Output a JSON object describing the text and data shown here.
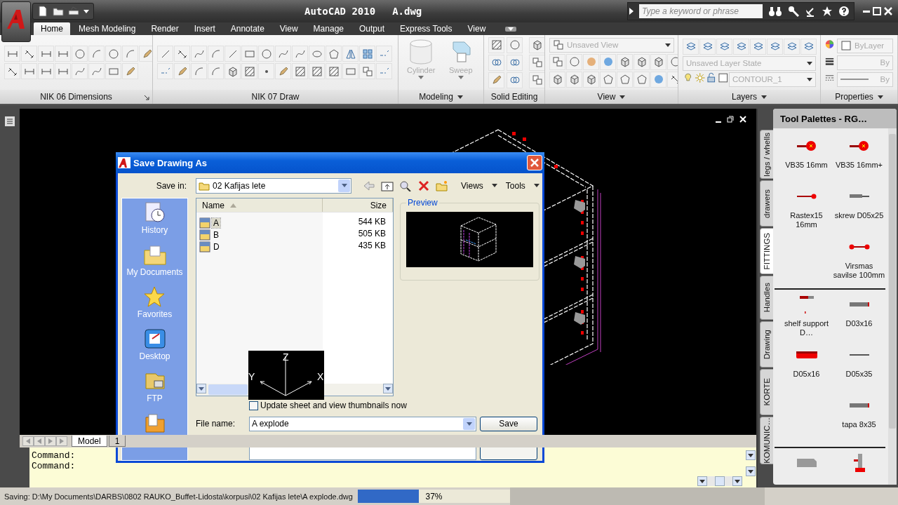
{
  "title_bar": {
    "title": "AutoCAD 2010",
    "document": "A.dwg",
    "search": {
      "placeholder": "Type a keyword or phrase"
    }
  },
  "ribbon_tabs": [
    {
      "label": "Home",
      "selected": true
    },
    {
      "label": "Mesh Modeling",
      "selected": false
    },
    {
      "label": "Render",
      "selected": false
    },
    {
      "label": "Insert",
      "selected": false
    },
    {
      "label": "Annotate",
      "selected": false
    },
    {
      "label": "View",
      "selected": false
    },
    {
      "label": "Manage",
      "selected": false
    },
    {
      "label": "Output",
      "selected": false
    },
    {
      "label": "Express Tools",
      "selected": false
    },
    {
      "label": "View",
      "selected": false
    }
  ],
  "ribbon_panels": [
    {
      "kind": "tools",
      "title": "NIK 06 Dimensions",
      "launcher": true,
      "menu": false
    },
    {
      "kind": "tools",
      "title": "NIK 07 Draw",
      "menu": false
    },
    {
      "kind": "big_buttons",
      "title": "Modeling",
      "menu": true,
      "buttons": [
        "Cylinder",
        "Sweep"
      ]
    },
    {
      "kind": "tools",
      "title": "Solid Editing",
      "menu": false
    },
    {
      "kind": "view",
      "title": "View",
      "menu": true,
      "view_select": "Unsaved View"
    },
    {
      "kind": "layers",
      "title": "Layers",
      "menu": true,
      "layer_state": "Unsaved Layer State",
      "current_layer": "CONTOUR_1"
    },
    {
      "kind": "properties",
      "title": "Properties",
      "menu": true,
      "color_select": "ByLayer",
      "lineweight": "By",
      "linetype": "By"
    }
  ],
  "ucs_icon": {
    "axes": [
      "Z",
      "Y",
      "X"
    ]
  },
  "layout_tabs": [
    {
      "label": "Model",
      "selected": true
    },
    {
      "label": "1",
      "selected": false
    }
  ],
  "command_lines": [
    "Command:",
    "Command:"
  ],
  "palette": {
    "title": "Tool Palettes - RG…",
    "tabs": [
      {
        "label": "legs / whells",
        "selected": false
      },
      {
        "label": "drawers",
        "selected": false
      },
      {
        "label": "FITTINGS",
        "selected": true
      },
      {
        "label": "Handles",
        "selected": false
      },
      {
        "label": "Drawing",
        "selected": false
      },
      {
        "label": "KORTE",
        "selected": false
      },
      {
        "label": "KOMUNIC…",
        "selected": false
      }
    ],
    "sections": [
      [
        {
          "kind": "hinge",
          "label": "VB35 16mm"
        },
        {
          "kind": "hinge",
          "label": "VB35 16mm+"
        },
        {
          "kind": "rastex",
          "label": "Rastex15 16mm"
        },
        {
          "kind": "screw",
          "label": "skrew D05x25"
        },
        {
          "kind": "dumbbell",
          "label": "Virsmas savilse 100mm"
        }
      ],
      [
        {
          "kind": "support",
          "label": "shelf support D…"
        },
        {
          "kind": "dowel",
          "label": "D03x16"
        },
        {
          "kind": "plate",
          "label": "D05x16"
        },
        {
          "kind": "pin",
          "label": "D05x35"
        },
        {
          "kind": "dowel",
          "label": "tapa 8x35"
        }
      ],
      [
        {
          "kind": "box"
        },
        {
          "kind": "bracket"
        }
      ]
    ]
  },
  "dialog": {
    "title": "Save Drawing As",
    "save_in_label": "Save in:",
    "save_in": "02 Kafijas lete",
    "menus": [
      "Views",
      "Tools"
    ],
    "places": [
      {
        "kind": "history",
        "label": "History"
      },
      {
        "kind": "documents",
        "label": "My Documents"
      },
      {
        "kind": "favorites",
        "label": "Favorites"
      },
      {
        "kind": "desktop",
        "label": "Desktop"
      },
      {
        "kind": "ftp",
        "label": "FTP"
      },
      {
        "kind": "folder"
      }
    ],
    "columns": [
      {
        "label": "Name",
        "sorted": true
      },
      {
        "label": "Size",
        "sorted": false
      }
    ],
    "files": [
      {
        "name": "A",
        "size": "544 KB",
        "selected": true
      },
      {
        "name": "B",
        "size": "505 KB",
        "selected": false
      },
      {
        "name": "D",
        "size": "435 KB",
        "selected": false
      }
    ],
    "preview_label": "Preview",
    "thumbnails": {
      "label": "Update sheet and view thumbnails now",
      "checked": false
    },
    "file_name_label": "File name:",
    "file_name": "A explode",
    "save_button": "Save"
  },
  "status_bar": {
    "text": "Saving: D:\\My Documents\\DARBS\\0802 RAUKO_Buffet-Lidosta\\korpusi\\02 Kafijas lete\\A explode.dwg",
    "progress": {
      "level": 0.4,
      "reading": "37%"
    }
  }
}
